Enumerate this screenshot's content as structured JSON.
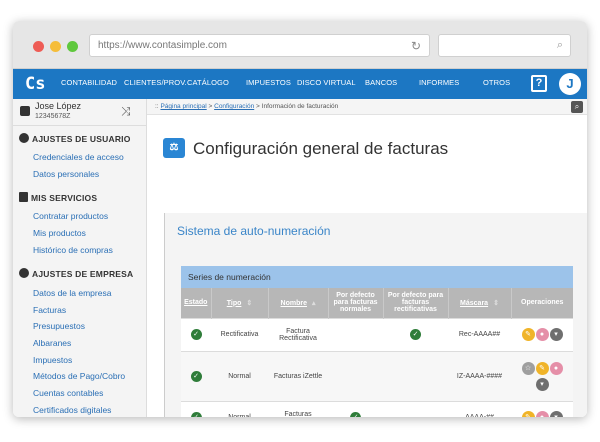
{
  "browser": {
    "url": "https://www.contasimple.com"
  },
  "topnav": {
    "logo": "Cs",
    "items": [
      "CONTABILIDAD",
      "CLIENTES/PROV.",
      "CATÁLOGO",
      "IMPUESTOS",
      "DISCO VIRTUAL",
      "BANCOS",
      "INFORMES",
      "OTROS"
    ],
    "help": "?",
    "avatar": "J",
    "color": "#1c77c3"
  },
  "user": {
    "name": "Jose López",
    "nif": "12345678Z"
  },
  "sidebar": {
    "sections": [
      {
        "title": "AJUSTES DE USUARIO",
        "icon": "gear-icon",
        "items": [
          "Credenciales de acceso",
          "Datos personales"
        ]
      },
      {
        "title": "MIS SERVICIOS",
        "icon": "briefcase-icon",
        "items": [
          "Contratar productos",
          "Mis productos",
          "Histórico de compras"
        ]
      },
      {
        "title": "AJUSTES DE EMPRESA",
        "icon": "gear-icon",
        "items": [
          "Datos de la empresa",
          "Facturas",
          "Presupuestos",
          "Albaranes",
          "Impuestos",
          "Métodos de Pago/Cobro",
          "Cuentas contables",
          "Certificados digitales"
        ]
      }
    ]
  },
  "breadcrumb": {
    "prefix": "::",
    "items": [
      "Página principal",
      "Configuración",
      "Información de facturación"
    ],
    "sep": ">"
  },
  "page": {
    "title": "Configuración general de facturas",
    "icon": "scales-icon"
  },
  "panel": {
    "title": "Sistema de auto-numeración"
  },
  "table": {
    "title": "Series de numeración",
    "headers": [
      "Estado",
      "Tipo",
      "Nombre",
      "Por defecto para facturas normales",
      "Por defecto para facturas rectificativas",
      "Máscara",
      "Operaciones"
    ],
    "rows": [
      {
        "estado": "active",
        "tipo": "Rectificativa",
        "nombre": "Factura Rectificativa",
        "def_normal": false,
        "def_rect": true,
        "mascara": "Rec-AAAA##",
        "ops": [
          "edit",
          "toggle",
          "menu"
        ]
      },
      {
        "estado": "active",
        "tipo": "Normal",
        "nombre": "Facturas iZettle",
        "def_normal": false,
        "def_rect": false,
        "mascara": "IZ-AAAA-####",
        "ops": [
          "star",
          "edit",
          "toggle",
          "menu"
        ]
      },
      {
        "estado": "active",
        "tipo": "Normal",
        "nombre": "Facturas normales",
        "def_normal": true,
        "def_rect": false,
        "mascara": "AAAA-##",
        "ops": [
          "edit",
          "toggle",
          "menu"
        ]
      }
    ]
  }
}
